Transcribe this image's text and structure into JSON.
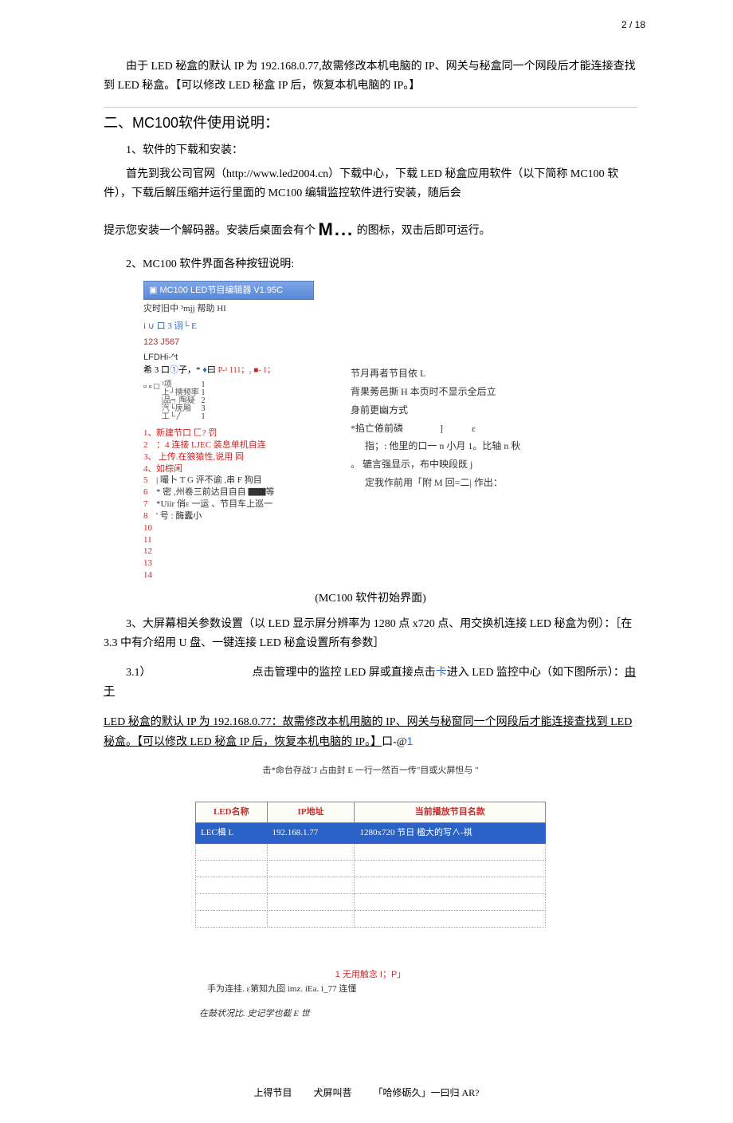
{
  "page_number": "2 / 18",
  "intro_para": "由于 LED 秘盒的默认 IP 为 192.168.0.77,故需修改本机电脑的 IP、网关与秘盒同一个网段后才能连接查找到 LED 秘盒。【可以修改 LED 秘盒 IP 后，恢复本机电脑的 IP。】",
  "h2_prefix": "二、",
  "h2_sans": "MC100",
  "h2_suffix": "软件使用说明：",
  "s1_title": "1、软件的下载和安装：",
  "s1_p1": "首先到我公司官网（http://www.led2004.cn）下载中心，下载 LED 秘盒应用软件（以下简称 MC100 软件），下载后解压缩并运行里面的 MC100 编辑监控软件进行安装，随后会",
  "s1_p2a": "提示您安装一个解码器。安装后桌面会有个",
  "s1_bigM": "M...",
  "s1_p2b": "的图标，双击后即可运行。",
  "s2_title": "2、MC100 软件界面各种按钮说明:",
  "app_title": "MC100 LED节目编辑器 V1.95C",
  "app_menu": "灾时旧中 ³mjj 帮助 HI",
  "app_tool1": "i ∪ 口 3 诩└ E",
  "app_tool2": "123 J567",
  "app_tool3": "LFDHi-^t",
  "app_line4a": "希 3 口",
  "app_line4b": "①",
  "app_line4c": "子，* ",
  "app_line4d": "♦",
  "app_line4e": "曰 ",
  "app_line4f": "P-¹ 111",
  "app_line4g": "；₁ ■- 1；",
  "right_l1": "节月再者节目依 L",
  "right_l2": "背果莠邑撕 H 本页时不显示全后立",
  "right_l3": "身前更幽方式",
  "right_l4a": "*掐亡倦前磷",
  "right_l4b": "]",
  "right_l4c": "ε",
  "right_l5": "指；: 他里的口一  n 小月 1。比轴 n 秋",
  "right_l6": "。 辘言强显示，布中映段既 j",
  "right_l7": "定我作前用「附 M 回=二| 作出：",
  "tree_node": "▫ ▫ □",
  "tree_text": "³项\n上┘摤频率\n|品┑陶疑\n汽└庑厢\n工└〳",
  "tree_nums": "1\n1\n2\n3\n1",
  "list": {
    "l1": {
      "n": "1、",
      "t": "新建节口  匚? 罚"
    },
    "l2": {
      "n": "2",
      "t": "：4 连接 LJEC 装息单机自连"
    },
    "l3": {
      "n": "3、",
      "t": "   上传.在狼猿性,说用  同"
    },
    "l4": {
      "n": "4、",
      "t": "如棕闲"
    },
    "l5": {
      "n": "5",
      "t": "| 嘬卜 T  G 评不谕 ,串 F 狗目"
    },
    "l6": {
      "n": "6",
      "t": "* 密 ,州卷三前达目自自 ▇▇等"
    },
    "l7": {
      "n": "7",
      "t": "*Uiir 俏ε 一运 、节目车上巡一"
    },
    "l8": {
      "n": "8",
      "t": "' 号 :  酶蠹小"
    },
    "l9": "10",
    "l10": "11",
    "l11": "12",
    "l12": "13",
    "l13": "14"
  },
  "caption": "(MC100 软件初始界面)",
  "s3_para": "3、大屏幕相关参数设置（以 LED 显示屏分辨率为 1280 点 x720 点、用交换机连接 LED 秘盒为例）：［在 3.3 中有介绍用 U 盘、一键连接 LED 秘盒设置所有参数］",
  "s31_a": "3.1）",
  "s31_b": "点击管理中的监控 LED 屏或直接点击",
  "s31_c": "卡",
  "s31_d": "进入 LED 监控中心（如下图所示）：",
  "s31_e": "由于",
  "s31_underline": "LED 秘盒的默认 IP 为 192.168.0.77：故需修改本机用脑的 IP、网关与秘窗同一个网段后才能连接查找到 LED 秘盒。【可以修改 LED 秘盒 IP 后，恢复本机电脑的 IP。】",
  "s31_tail": "口-@",
  "s31_tail2": "1",
  "note_line": "击*命台存战˘J 占由封 E 一行一然百一传\"目或火屏怛与 \"",
  "table": {
    "h1": "LED名称",
    "h2": "IP地址",
    "h3": "当前播放节目名款",
    "r1c1": "LEC楫 L",
    "r1c2": "192.168.1.77",
    "r1c3": "1280x720 节日 楹大的写∧-祺"
  },
  "foot_red": "1 无用触念 I；P」",
  "foot_line2": "手为连挂. ε第知九囵 imz. iEa. i_77 连懂",
  "foot_line3": "在鼓状况比. 史记学也截 E 世",
  "bottom": {
    "a": "上得节目",
    "b": "犬屏叫菩",
    "c": "「哈修砺久」一曰归 AR?"
  }
}
